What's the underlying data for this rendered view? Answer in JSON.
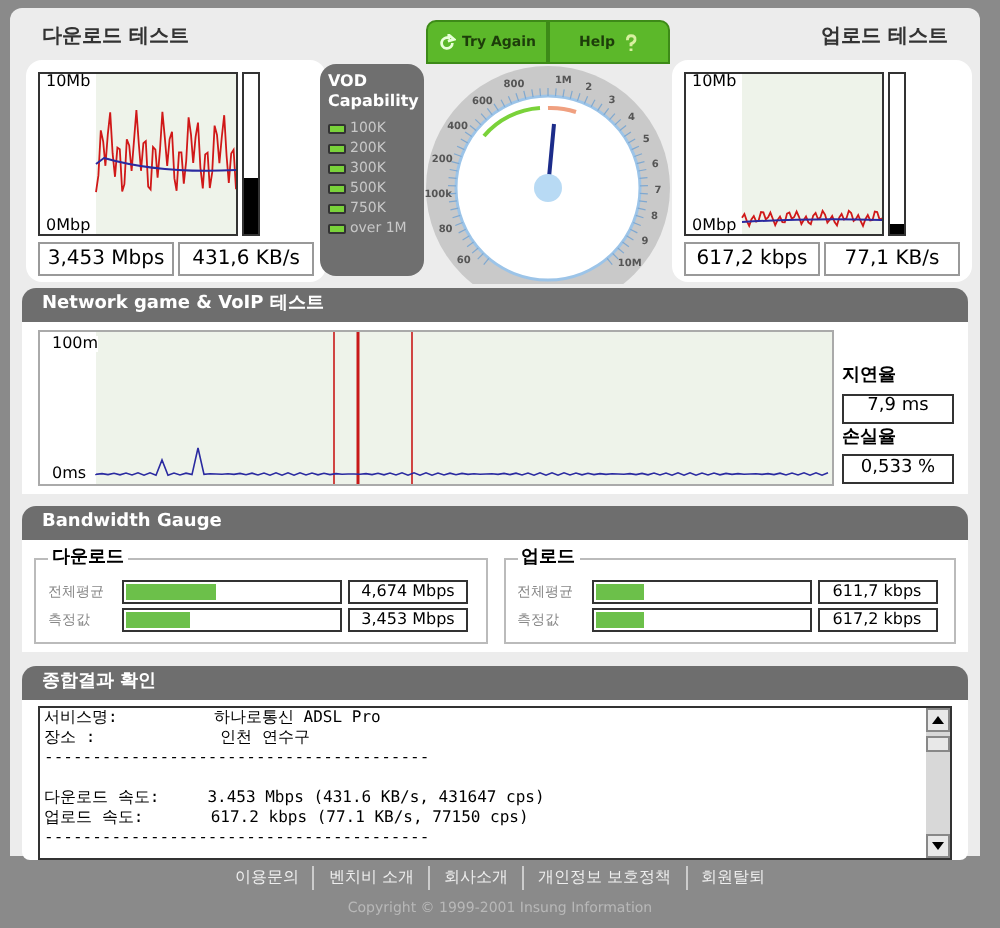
{
  "download": {
    "title": "다운로드 테스트",
    "y_max": "10Mb",
    "y_min": "0Mbp",
    "meter": {
      "level": 0.35
    },
    "readings": [
      "3,453 Mbps",
      "431,6 KB/s"
    ]
  },
  "vod": {
    "title": "VOD Capability",
    "items": [
      {
        "label": "100K",
        "on": true
      },
      {
        "label": "200K",
        "on": true
      },
      {
        "label": "300K",
        "on": true
      },
      {
        "label": "500K",
        "on": true
      },
      {
        "label": "750K",
        "on": true
      },
      {
        "label": "over 1M",
        "on": true
      }
    ]
  },
  "buttons": [
    {
      "label": "Try Again",
      "kind": "retry"
    },
    {
      "label": "Help",
      "kind": "help"
    }
  ],
  "dial": {
    "left_labels": [
      "800",
      "600",
      "400",
      "200",
      "100k",
      "80",
      "60"
    ],
    "right_labels": [
      "1M",
      "2",
      "3",
      "4",
      "5",
      "6",
      "7",
      "8",
      "9",
      "10M"
    ]
  },
  "upload": {
    "title": "업로드 테스트",
    "y_max": "10Mb",
    "y_min": "0Mbp",
    "meter": {
      "level": 0.06
    },
    "readings": [
      "617,2 kbps",
      "77,1 KB/s"
    ]
  },
  "network": {
    "header": "Network game & VoIP 테스트",
    "y_max": "100m",
    "y_min": "0ms",
    "latency_label": "지연율",
    "latency": "7,9 ms",
    "loss_label": "손실율",
    "loss": "0,533 %"
  },
  "bandwidth": {
    "header": "Bandwidth Gauge",
    "groups": [
      {
        "title": "다운로드",
        "rows": [
          {
            "label": "전체평균",
            "level": 0.42,
            "value": "4,674 Mbps"
          },
          {
            "label": "측정값",
            "level": 0.3,
            "value": "3,453 Mbps"
          }
        ]
      },
      {
        "title": "업로드",
        "rows": [
          {
            "label": "전체평균",
            "level": 0.23,
            "value": "611,7 kbps"
          },
          {
            "label": "측정값",
            "level": 0.23,
            "value": "617,2 kbps"
          }
        ]
      }
    ]
  },
  "summary": {
    "header": "종합결과 확인",
    "blocks": [
      [
        "서비스명:          하나로통신 ADSL Pro",
        "장소 :             인천 연수구",
        "----------------------------------------"
      ],
      [
        "다운로드 속도:     3.453 Mbps (431.6 KB/s, 431647 cps)",
        "업로드 속도:       617.2 kbps (77.1 KB/s, 77150 cps)",
        "----------------------------------------"
      ]
    ]
  },
  "footer": {
    "links": [
      "이용문의",
      "벤치비 소개",
      "회사소개",
      "개인정보 보호정책",
      "회원탈퇴"
    ],
    "copyright": "Copyright © 1999-2001 Insung Information"
  }
}
